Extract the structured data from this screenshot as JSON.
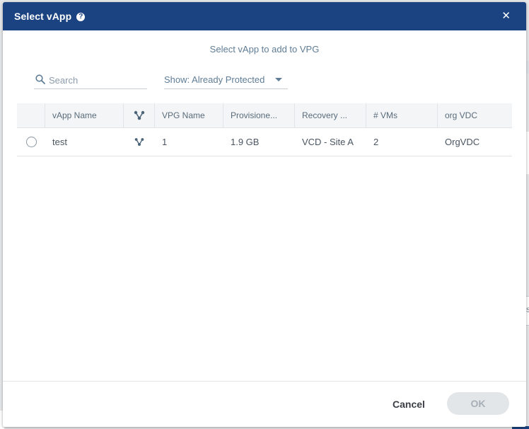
{
  "dialog": {
    "title": "Select vApp",
    "help_icon": "question-circle-icon",
    "close_icon": "close-icon",
    "close_glyph": "✕",
    "subtitle": "Select vApp to add to VPG"
  },
  "filters": {
    "search_placeholder": "Search",
    "search_value": "",
    "show_label": "Show: Already Protected"
  },
  "table": {
    "columns": [
      {
        "key": "select",
        "label": ""
      },
      {
        "key": "vapp_name",
        "label": "vApp Name"
      },
      {
        "key": "topology",
        "label": "",
        "icon": "vapp-topology-icon"
      },
      {
        "key": "vpg_name",
        "label": "VPG Name"
      },
      {
        "key": "provisioned",
        "label": "Provisione..."
      },
      {
        "key": "recovery",
        "label": "Recovery ..."
      },
      {
        "key": "vms",
        "label": "# VMs"
      },
      {
        "key": "org_vdc",
        "label": "org VDC"
      }
    ],
    "rows": [
      {
        "selected": false,
        "vapp_name": "test",
        "vpg_name": "1",
        "provisioned": "1.9 GB",
        "recovery": "VCD - Site A",
        "vms": "2",
        "org_vdc": "OrgVDC"
      }
    ]
  },
  "footer": {
    "cancel_label": "Cancel",
    "ok_label": "OK"
  },
  "background": {
    "peek_letter": "s"
  },
  "colors": {
    "header_bg": "#1b4381",
    "subtitle": "#5f7d96",
    "ok_disabled_bg": "#e3e6e9",
    "ok_disabled_text": "#a7afb7"
  }
}
